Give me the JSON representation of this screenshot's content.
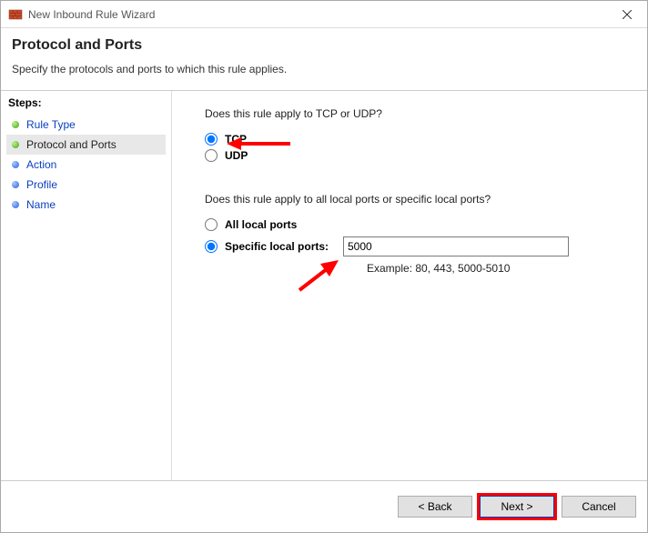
{
  "window": {
    "title": "New Inbound Rule Wizard"
  },
  "header": {
    "title": "Protocol and Ports",
    "description": "Specify the protocols and ports to which this rule applies."
  },
  "steps": {
    "title": "Steps:",
    "items": [
      {
        "label": "Rule Type",
        "style": "link",
        "bullet": "green",
        "current": false
      },
      {
        "label": "Protocol and Ports",
        "style": "plain",
        "bullet": "green",
        "current": true
      },
      {
        "label": "Action",
        "style": "link",
        "bullet": "blue",
        "current": false
      },
      {
        "label": "Profile",
        "style": "link",
        "bullet": "blue",
        "current": false
      },
      {
        "label": "Name",
        "style": "link",
        "bullet": "blue",
        "current": false
      }
    ]
  },
  "content": {
    "protocol_question": "Does this rule apply to TCP or UDP?",
    "protocol": {
      "tcp_label": "TCP",
      "udp_label": "UDP",
      "selected": "tcp"
    },
    "ports_question": "Does this rule apply to all local ports or specific local ports?",
    "ports": {
      "all_label": "All local ports",
      "specific_label": "Specific local ports:",
      "selected": "specific",
      "specific_value": "5000",
      "example": "Example: 80, 443, 5000-5010"
    }
  },
  "footer": {
    "back": "< Back",
    "next": "Next >",
    "cancel": "Cancel"
  }
}
